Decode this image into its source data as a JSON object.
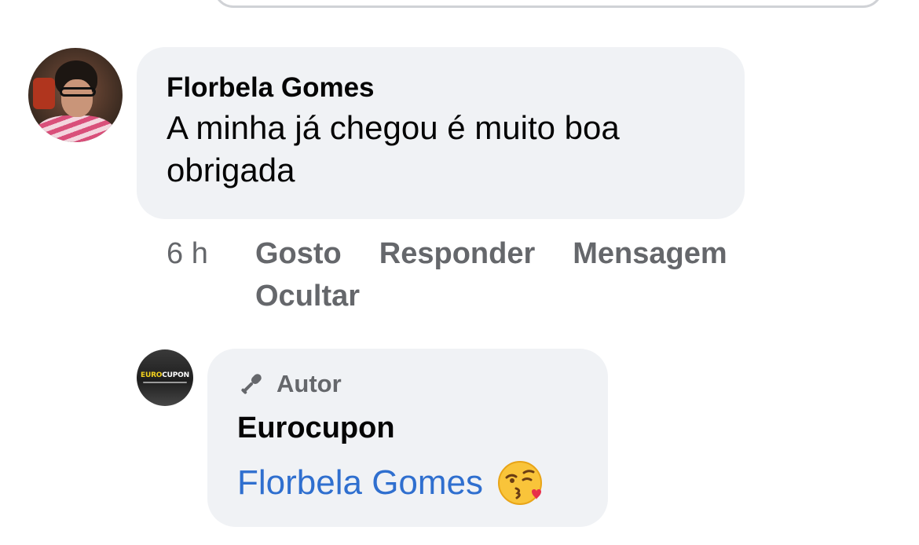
{
  "comment": {
    "author": "Florbela Gomes",
    "text": "A minha já chegou é muito boa obrigada",
    "time": "6 h",
    "actions": {
      "like": "Gosto",
      "reply": "Responder",
      "message": "Mensagem",
      "hide": "Ocultar"
    }
  },
  "reply": {
    "badge": "Autor",
    "badge_icon": "microphone-icon",
    "author": "Eurocupon",
    "mention": "Florbela Gomes",
    "emoji": "face-blowing-a-kiss",
    "avatar_logo": {
      "part1": "EURO",
      "part2": "CUPON"
    }
  },
  "colors": {
    "bubble_bg": "#f0f2f5",
    "meta_text": "#65676b",
    "mention": "#2f6fcf",
    "logo_yellow": "#f2d01d"
  }
}
